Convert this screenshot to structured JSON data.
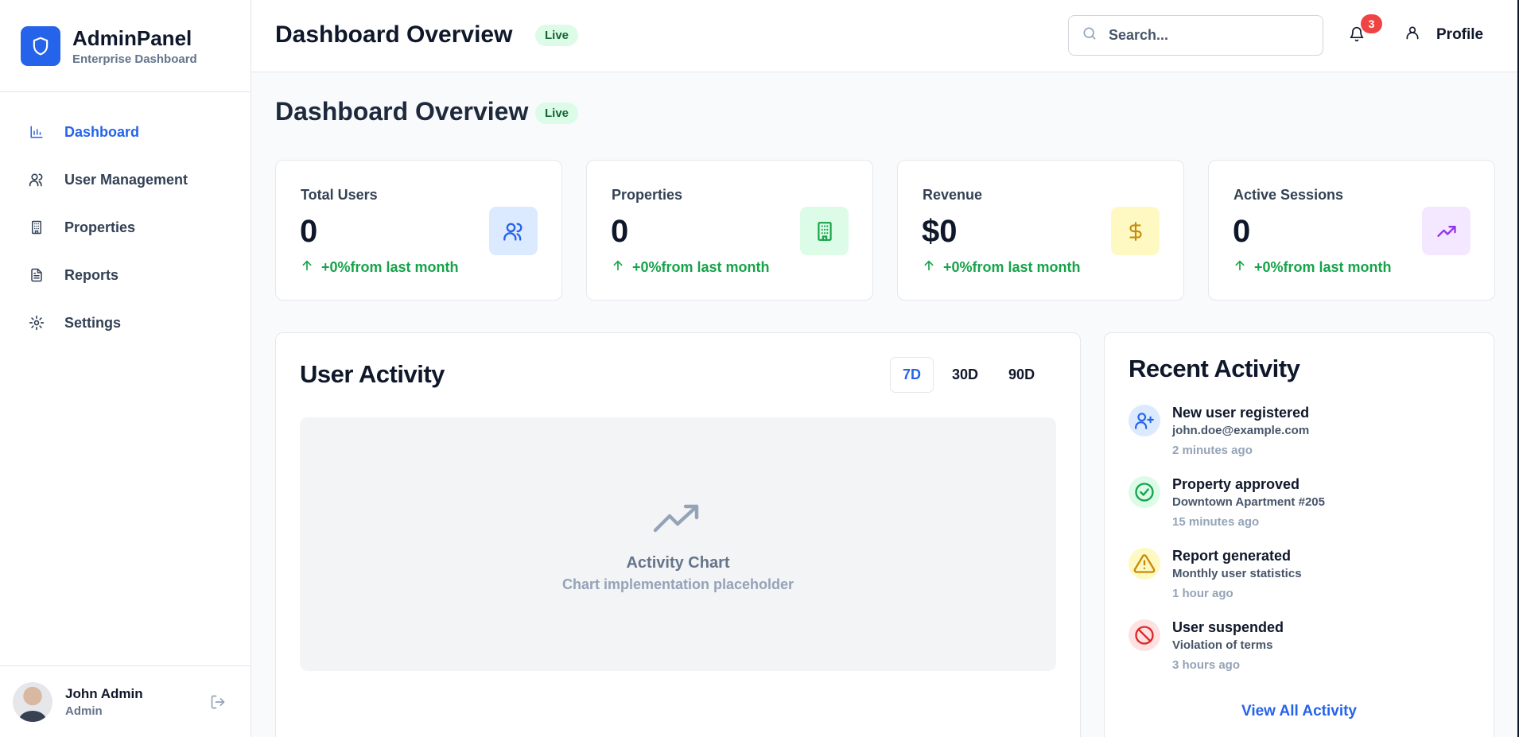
{
  "brand": {
    "title": "AdminPanel",
    "subtitle": "Enterprise Dashboard",
    "logo_icon": "shield-icon",
    "accent": "#2563eb"
  },
  "sidebar": {
    "items": [
      {
        "label": "Dashboard",
        "icon": "bar-chart-icon",
        "active": true
      },
      {
        "label": "User Management",
        "icon": "users-icon",
        "active": false
      },
      {
        "label": "Properties",
        "icon": "building-icon",
        "active": false
      },
      {
        "label": "Reports",
        "icon": "file-text-icon",
        "active": false
      },
      {
        "label": "Settings",
        "icon": "gear-icon",
        "active": false
      }
    ],
    "user": {
      "name": "John Admin",
      "role": "Admin",
      "logout_icon": "logout-icon"
    }
  },
  "header": {
    "title": "Dashboard Overview",
    "live_badge": "Live",
    "search_placeholder": "Search...",
    "notification_count": "3",
    "profile_label": "Profile"
  },
  "main": {
    "title": "Dashboard Overview",
    "live_badge": "Live",
    "stats": [
      {
        "label": "Total Users",
        "value": "0",
        "change": "+0%from last month",
        "icon": "users-icon",
        "icon_bg": "#dbeafe",
        "icon_color": "#2563eb"
      },
      {
        "label": "Properties",
        "value": "0",
        "change": "+0%from last month",
        "icon": "building-icon",
        "icon_bg": "#dcfce7",
        "icon_color": "#16a34a"
      },
      {
        "label": "Revenue",
        "value": "$0",
        "change": "+0%from last month",
        "icon": "dollar-icon",
        "icon_bg": "#fef9c3",
        "icon_color": "#ca8a04"
      },
      {
        "label": "Active Sessions",
        "value": "0",
        "change": "+0%from last month",
        "icon": "trending-up-icon",
        "icon_bg": "#f3e8ff",
        "icon_color": "#9333ea"
      }
    ],
    "activity": {
      "title": "User Activity",
      "ranges": [
        "7D",
        "30D",
        "90D"
      ],
      "selected_range": "7D",
      "chart_title": "Activity Chart",
      "chart_subtitle": "Chart implementation placeholder"
    },
    "recent": {
      "title": "Recent Activity",
      "items": [
        {
          "title": "New user registered",
          "desc": "john.doe@example.com",
          "time": "2 minutes ago",
          "icon": "user-plus-icon",
          "bg": "#dbeafe",
          "color": "#2563eb"
        },
        {
          "title": "Property approved",
          "desc": "Downtown Apartment #205",
          "time": "15 minutes ago",
          "icon": "check-circle-icon",
          "bg": "#dcfce7",
          "color": "#16a34a"
        },
        {
          "title": "Report generated",
          "desc": "Monthly user statistics",
          "time": "1 hour ago",
          "icon": "warning-icon",
          "bg": "#fef9c3",
          "color": "#ca8a04"
        },
        {
          "title": "User suspended",
          "desc": "Violation of terms",
          "time": "3 hours ago",
          "icon": "ban-icon",
          "bg": "#fee2e2",
          "color": "#dc2626"
        }
      ],
      "view_all": "View All Activity"
    }
  }
}
